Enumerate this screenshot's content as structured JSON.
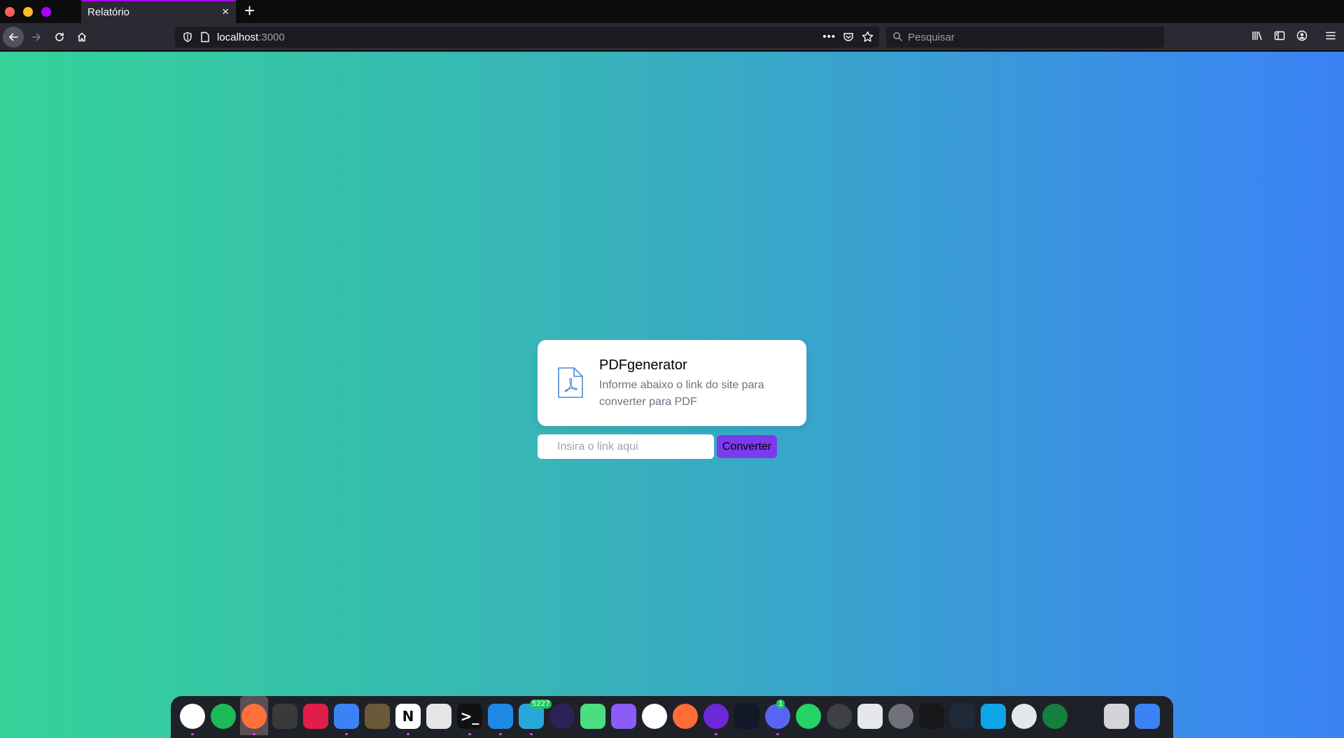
{
  "browser": {
    "tab": {
      "title": "Relatório",
      "close_icon": "×"
    },
    "new_tab_icon": "+",
    "url": {
      "host": "localhost",
      "port": ":3000"
    },
    "search": {
      "placeholder": "Pesquisar"
    },
    "accent": "#b000ff"
  },
  "page": {
    "title": "PDFgenerator",
    "description": "Informe abaixo o link do site para converter para PDF",
    "input_placeholder": "Insira o link aqui",
    "button_label": "Converter",
    "gradient": [
      "#34d399",
      "#3b82f6"
    ],
    "button_color": "#7c3aed"
  },
  "dock": {
    "items": [
      {
        "name": "chrome-icon",
        "color": "#ffffff",
        "running": true
      },
      {
        "name": "spotify-icon",
        "color": "#1db954",
        "running": false
      },
      {
        "name": "firefox-icon",
        "color": "#ff7139",
        "running": true,
        "active": true
      },
      {
        "name": "screenshot-icon",
        "color": "#3a3a3a",
        "running": false
      },
      {
        "name": "flameshot-icon",
        "color": "#e11d48",
        "running": false
      },
      {
        "name": "finder-icon",
        "color": "#3b82f6",
        "running": true
      },
      {
        "name": "gimp-icon",
        "color": "#6b5a3a",
        "running": false
      },
      {
        "name": "notion-icon",
        "color": "#ffffff",
        "running": true,
        "glyph": "N"
      },
      {
        "name": "text-editor-icon",
        "color": "#e5e5e5",
        "running": false
      },
      {
        "name": "terminal-icon",
        "color": "#111111",
        "running": true,
        "glyph": ">_"
      },
      {
        "name": "vscode-icon",
        "color": "#1e88e5",
        "running": true
      },
      {
        "name": "telegram-icon",
        "color": "#2aa7d9",
        "running": true,
        "badge": "5227"
      },
      {
        "name": "eclipse-icon",
        "color": "#2c2255",
        "running": false
      },
      {
        "name": "rocket-icon",
        "color": "#4ade80",
        "running": false
      },
      {
        "name": "github-desktop-icon",
        "color": "#8b5cf6",
        "running": false
      },
      {
        "name": "mongodb-compass-icon",
        "color": "#ffffff",
        "running": false
      },
      {
        "name": "postman-icon",
        "color": "#ff6c37",
        "running": false
      },
      {
        "name": "dbeaver-icon",
        "color": "#6d28d9",
        "running": true
      },
      {
        "name": "remote-desktop-icon",
        "color": "#111827",
        "running": false
      },
      {
        "name": "discord-icon",
        "color": "#5865f2",
        "running": true,
        "badge": "1"
      },
      {
        "name": "whatsapp-icon",
        "color": "#25d366",
        "running": false
      },
      {
        "name": "settings-icon",
        "color": "#3f3f46",
        "running": false
      },
      {
        "name": "tweaks-icon",
        "color": "#e5e7eb",
        "running": false
      },
      {
        "name": "system-preferences-icon",
        "color": "#71717a",
        "running": false
      },
      {
        "name": "activity-monitor-icon",
        "color": "#18181b",
        "running": false
      },
      {
        "name": "calculator-icon",
        "color": "#1f2937",
        "running": false
      },
      {
        "name": "app-store-icon",
        "color": "#0ea5e9",
        "running": false
      },
      {
        "name": "network-icon",
        "color": "#e5e7eb",
        "running": false
      },
      {
        "name": "radar-icon",
        "color": "#15803d",
        "running": false
      },
      {
        "name": "scissors-icon",
        "color": "transparent",
        "running": false
      },
      {
        "name": "trash-icon",
        "color": "#d4d4d8",
        "running": false
      },
      {
        "name": "app-launcher-icon",
        "color": "#3b82f6",
        "running": false
      }
    ]
  }
}
